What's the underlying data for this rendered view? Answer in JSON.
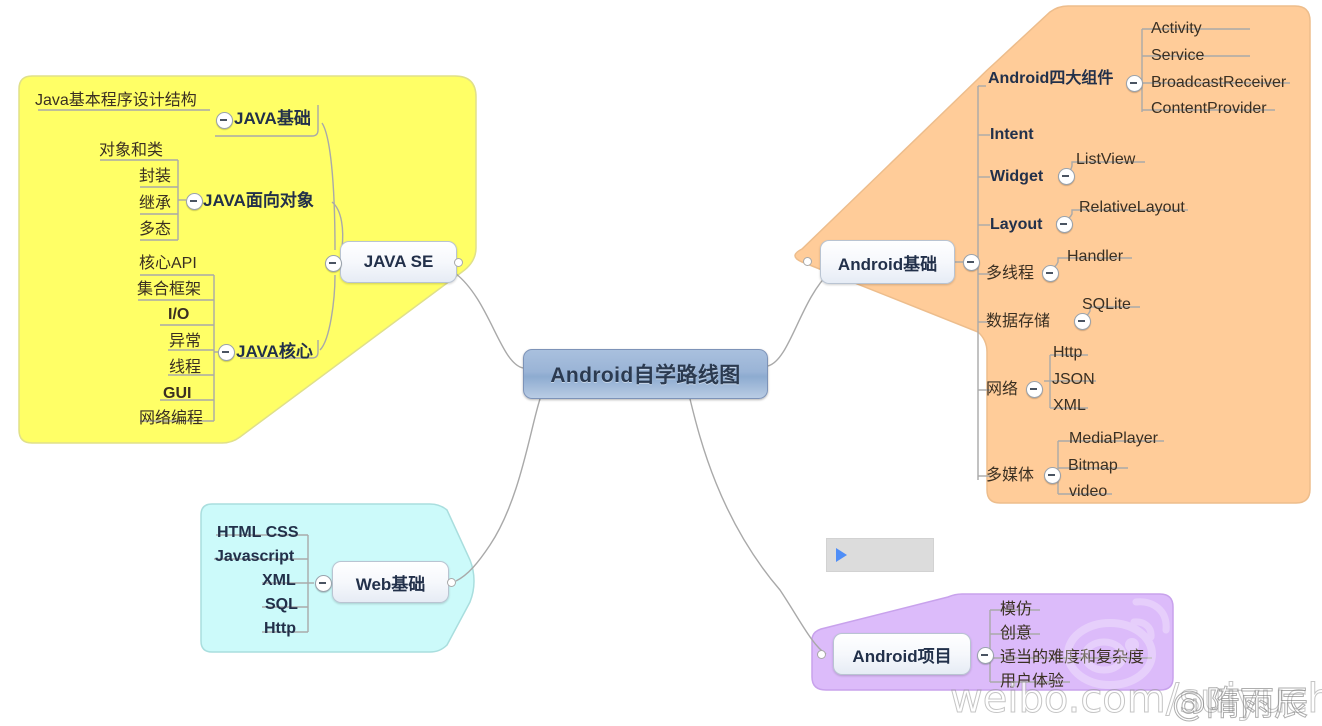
{
  "root": {
    "label": "Android自学路线图"
  },
  "colors": {
    "java_branch": "#FFFF66",
    "android_branch": "#FFCC99",
    "web_branch": "#CCFAFA",
    "project_branch": "#DCBBFA",
    "root_node": "#9AB4D6",
    "link_line": "#A9A9A9",
    "play_icon": "#4F8EF7"
  },
  "branches": {
    "java_se": {
      "node_label": "JAVA SE",
      "groups": [
        {
          "label": "JAVA基础",
          "children": [
            "Java基本程序设计结构"
          ]
        },
        {
          "label": "JAVA面向对象",
          "children": [
            "对象和类",
            "封装",
            "继承",
            "多态"
          ]
        },
        {
          "label": "JAVA核心",
          "children": [
            "核心API",
            "集合框架",
            "I/O",
            "异常",
            "线程",
            "GUI",
            "网络编程"
          ]
        }
      ]
    },
    "android_basic": {
      "node_label": "Android基础",
      "groups": [
        {
          "label": "Android四大组件",
          "children": [
            "Activity",
            "Service",
            "BroadcastReceiver",
            "ContentProvider"
          ]
        },
        {
          "label": "Intent",
          "children": []
        },
        {
          "label": "Widget",
          "children": [
            "ListView"
          ]
        },
        {
          "label": "Layout",
          "children": [
            "RelativeLayout"
          ]
        },
        {
          "label": "多线程",
          "children": [
            "Handler"
          ]
        },
        {
          "label": "数据存储",
          "children": [
            "SQLite"
          ]
        },
        {
          "label": "网络",
          "children": [
            "Http",
            "JSON",
            "XML"
          ]
        },
        {
          "label": "多媒体",
          "children": [
            "MediaPlayer",
            "Bitmap",
            "video"
          ]
        }
      ]
    },
    "web_basic": {
      "node_label": "Web基础",
      "children": [
        "HTML CSS",
        "Javascript",
        "XML",
        "SQL",
        "Http"
      ]
    },
    "android_project": {
      "node_label": "Android项目",
      "children": [
        "模仿",
        "创意",
        "适当的难度和复杂度",
        "用户体验"
      ]
    }
  },
  "watermark": {
    "url": "weibo.com/suiyuchen",
    "handle": "@隋雨辰",
    "logo_name": "weibo-logo"
  },
  "media_placeholder": {
    "icon": "play-icon"
  }
}
